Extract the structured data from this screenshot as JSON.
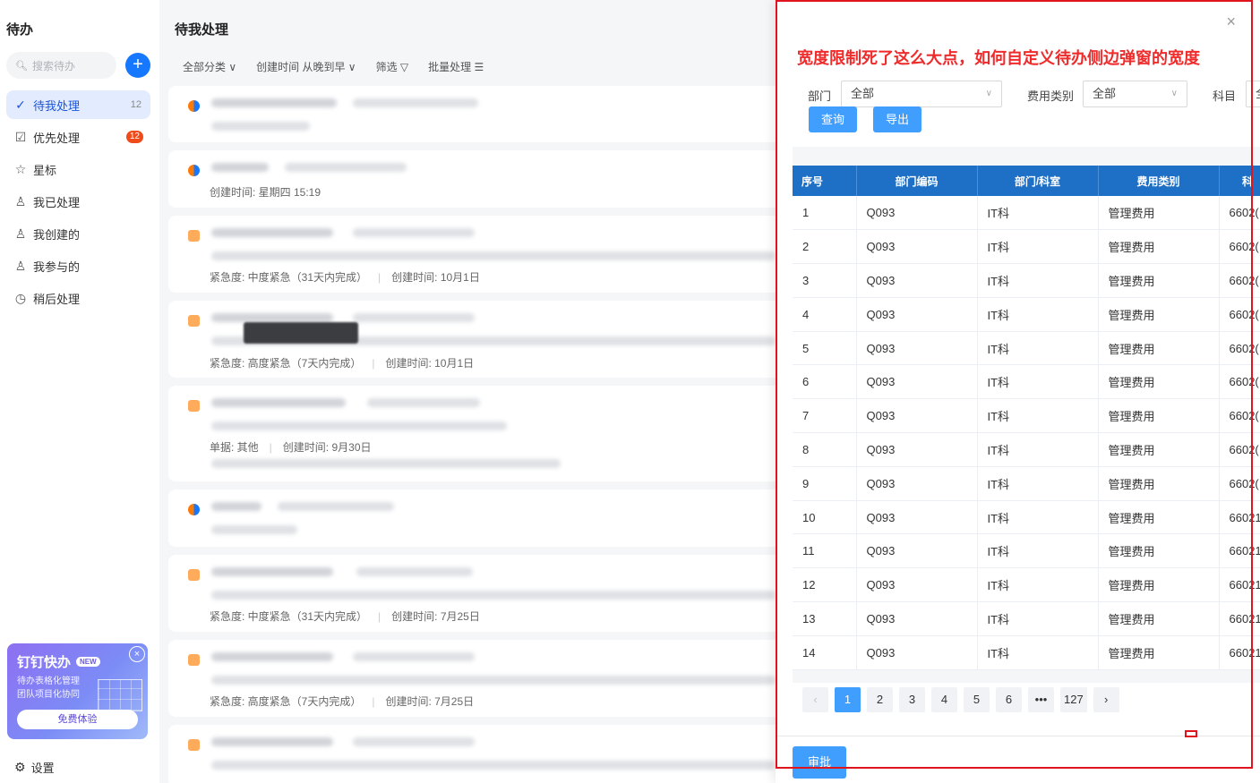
{
  "sidebar": {
    "title": "待办",
    "search_placeholder": "搜索待办",
    "add_label": "+",
    "items": [
      {
        "label": "待我处理",
        "icon": "check-circle-icon",
        "count": "12"
      },
      {
        "label": "优先处理",
        "icon": "check-square-icon",
        "badge": "12"
      },
      {
        "label": "星标",
        "icon": "star-icon"
      },
      {
        "label": "我已处理",
        "icon": "user-check-icon"
      },
      {
        "label": "我创建的",
        "icon": "user-icon"
      },
      {
        "label": "我参与的",
        "icon": "user-group-icon"
      },
      {
        "label": "稍后处理",
        "icon": "clock-icon"
      }
    ],
    "promo": {
      "title": "钉钉快办",
      "tag": "NEW",
      "line1": "待办表格化管理",
      "line2": "团队项目化协同",
      "button": "免费体验"
    },
    "settings": "设置"
  },
  "middle": {
    "title": "待我处理",
    "filters": [
      "全部分类 ∨",
      "创建时间 从晚到早 ∨",
      "筛选 ▽",
      "批量处理 ☰"
    ],
    "cards": [
      {
        "meta": []
      },
      {
        "meta": [
          "创建时间: 星期四 15:19"
        ]
      },
      {
        "meta": [
          "紧急度: 中度紧急（31天内完成）",
          "创建时间: 10月1日"
        ]
      },
      {
        "meta": [
          "紧急度: 高度紧急（7天内完成）",
          "创建时间: 10月1日"
        ]
      },
      {
        "meta": [
          "单据: 其他",
          "创建时间: 9月30日"
        ]
      },
      {
        "meta": []
      },
      {
        "meta": [
          "紧急度: 中度紧急（31天内完成）",
          "创建时间: 7月25日"
        ]
      },
      {
        "meta": [
          "紧急度: 高度紧急（7天内完成）",
          "创建时间: 7月25日"
        ]
      },
      {
        "meta": []
      }
    ]
  },
  "drawer": {
    "close": "×",
    "annotation": "宽度限制死了这么大点，如何自定义待办侧边弹窗的宽度",
    "query": {
      "dept_label": "部门",
      "dept_value": "全部",
      "fee_label": "费用类别",
      "fee_value": "全部",
      "subject_label": "科目",
      "subject_value": "全",
      "search_btn": "查询",
      "export_btn": "导出"
    },
    "table": {
      "headers": [
        "序号",
        "部门编码",
        "部门/科室",
        "费用类别",
        "科"
      ],
      "rows": [
        [
          "1",
          "Q093",
          "IT科",
          "管理费用",
          "6602("
        ],
        [
          "2",
          "Q093",
          "IT科",
          "管理费用",
          "6602("
        ],
        [
          "3",
          "Q093",
          "IT科",
          "管理费用",
          "6602("
        ],
        [
          "4",
          "Q093",
          "IT科",
          "管理费用",
          "6602("
        ],
        [
          "5",
          "Q093",
          "IT科",
          "管理费用",
          "6602("
        ],
        [
          "6",
          "Q093",
          "IT科",
          "管理费用",
          "6602("
        ],
        [
          "7",
          "Q093",
          "IT科",
          "管理费用",
          "6602("
        ],
        [
          "8",
          "Q093",
          "IT科",
          "管理费用",
          "6602("
        ],
        [
          "9",
          "Q093",
          "IT科",
          "管理费用",
          "6602("
        ],
        [
          "10",
          "Q093",
          "IT科",
          "管理费用",
          "66021"
        ],
        [
          "11",
          "Q093",
          "IT科",
          "管理费用",
          "66021"
        ],
        [
          "12",
          "Q093",
          "IT科",
          "管理费用",
          "66021"
        ],
        [
          "13",
          "Q093",
          "IT科",
          "管理费用",
          "66021"
        ],
        [
          "14",
          "Q093",
          "IT科",
          "管理费用",
          "66021"
        ]
      ]
    },
    "pager": [
      "‹",
      "1",
      "2",
      "3",
      "4",
      "5",
      "6",
      "•••",
      "127",
      "›"
    ],
    "approve_btn": "审批"
  }
}
